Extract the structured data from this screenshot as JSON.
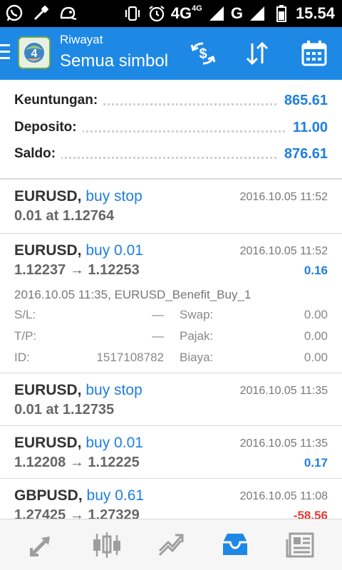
{
  "status_bar": {
    "network": "4G",
    "network_sup": "4G",
    "network2": "G",
    "time": "15.54"
  },
  "app_bar": {
    "subtitle": "Riwayat",
    "title": "Semua simbol"
  },
  "summary": [
    {
      "label": "Keuntungan:",
      "value": "865.61"
    },
    {
      "label": "Deposito:",
      "value": "11.00"
    },
    {
      "label": "Saldo:",
      "value": "876.61"
    }
  ],
  "orders": [
    {
      "symbol": "EURUSD,",
      "type": "buy stop",
      "time": "2016.10.05 11:52",
      "line2": "0.01 at 1.12764"
    },
    {
      "symbol": "EURUSD,",
      "type": "buy 0.01",
      "time": "2016.10.05 11:52",
      "line2": "1.12237 → 1.12253",
      "profit": "0.16",
      "details": {
        "comment": "2016.10.05 11:35, EURUSD_Benefit_Buy_1",
        "sl_label": "S/L:",
        "sl_value": "—",
        "tp_label": "T/P:",
        "tp_value": "—",
        "id_label": "ID:",
        "id_value": "1517108782",
        "swap_label": "Swap:",
        "swap_value": "0.00",
        "pajak_label": "Pajak:",
        "pajak_value": "0.00",
        "biaya_label": "Biaya:",
        "biaya_value": "0.00"
      }
    },
    {
      "symbol": "EURUSD,",
      "type": "buy stop",
      "time": "2016.10.05 11:35",
      "line2": "0.01 at 1.12735"
    },
    {
      "symbol": "EURUSD,",
      "type": "buy 0.01",
      "time": "2016.10.05 11:35",
      "line2": "1.12208 → 1.12225",
      "profit": "0.17"
    },
    {
      "symbol": "GBPUSD,",
      "type": "buy 0.61",
      "time": "2016.10.05 11:08",
      "line2": "1.27425 → 1.27329",
      "profit": "-58.56"
    }
  ],
  "colors": {
    "accent": "#1e88e5",
    "value_blue": "#1e7fe0",
    "negative": "#e53935"
  },
  "icons": {
    "app_bar": [
      "currency-exchange-icon",
      "sort-icon",
      "calendar-icon"
    ],
    "bottom_nav": [
      "trade-icon",
      "chart-candles-icon",
      "trend-icon",
      "history-inbox-icon",
      "news-icon"
    ]
  }
}
